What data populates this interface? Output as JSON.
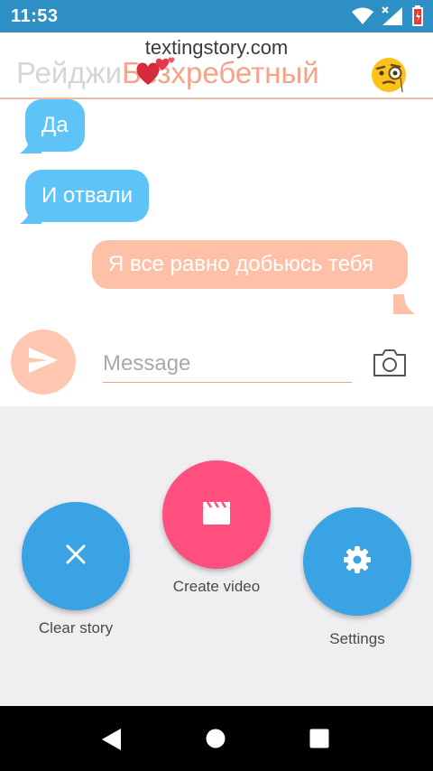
{
  "status_bar": {
    "time": "11:53",
    "icons": [
      "wifi-icon",
      "signal-icon",
      "battery-icon"
    ],
    "bg_color": "#2e8fc4"
  },
  "header": {
    "watermark": "textingstory.com",
    "contact_name": "Рейджи",
    "contact_description": "Безхребетный",
    "icons": [
      "hearts-emoji-icon",
      "monocle-emoji-icon"
    ]
  },
  "messages": [
    {
      "side": "incoming",
      "text": "Да"
    },
    {
      "side": "incoming",
      "text": "И отвали"
    },
    {
      "side": "outgoing",
      "text": "Я все равно добьюсь тебя"
    }
  ],
  "composer": {
    "placeholder": "Message",
    "send_icon": "send-icon",
    "camera_icon": "camera-icon"
  },
  "actions": {
    "clear_story": {
      "label": "Clear story",
      "icon": "close-icon",
      "color": "#3aa3e3"
    },
    "create_video": {
      "label": "Create video",
      "icon": "clapperboard-icon",
      "color": "#fe4f7f"
    },
    "settings": {
      "label": "Settings",
      "icon": "gear-icon",
      "color": "#3aa3e3"
    }
  },
  "nav_bar": {
    "icons": [
      "back-icon",
      "home-icon",
      "recents-icon"
    ]
  },
  "colors": {
    "incoming_bubble": "#5ec4f8",
    "outgoing_bubble": "#ffc0a8",
    "accent": "#f5a38a"
  }
}
